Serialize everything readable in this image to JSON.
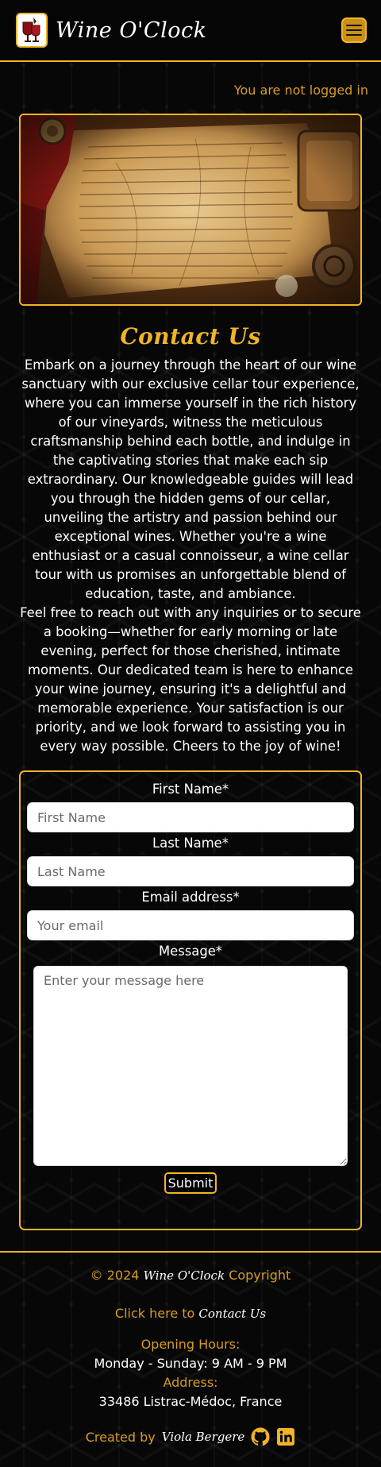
{
  "header": {
    "brand_name": "Wine O'Clock",
    "logo_icon": "wine-glass-icon",
    "menu_icon": "hamburger-menu-icon"
  },
  "login_status": "You are not logged in",
  "hero": {
    "image": "old-parchment-letters-image"
  },
  "main": {
    "title": "Contact Us",
    "intro_p1": "Embark on a journey through the heart of our wine sanctuary with our exclusive cellar tour experience, where you can immerse yourself in the rich history of our vineyards, witness the meticulous craftsmanship behind each bottle, and indulge in the captivating stories that make each sip extraordinary. Our knowledgeable guides will lead you through the hidden gems of our cellar, unveiling the artistry and passion behind our exceptional wines. Whether you're a wine enthusiast or a casual connoisseur, a wine cellar tour with us promises an unforgettable blend of education, taste, and ambiance.",
    "intro_p2": "Feel free to reach out with any inquiries or to secure a booking—whether for early morning or late evening, perfect for those cherished, intimate moments. Our dedicated team is here to enhance your wine journey, ensuring it's a delightful and memorable experience. Your satisfaction is our priority, and we look forward to assisting you in every way possible. Cheers to the joy of wine!"
  },
  "form": {
    "first_name_label": "First Name*",
    "first_name_placeholder": "First Name",
    "first_name_value": "",
    "last_name_label": "Last Name*",
    "last_name_placeholder": "Last Name",
    "last_name_value": "",
    "email_label": "Email address*",
    "email_placeholder": "Your email",
    "email_value": "",
    "message_label": "Message*",
    "message_placeholder": "Enter your message here",
    "message_value": "",
    "submit_label": "Submit"
  },
  "footer": {
    "copyright_prefix": "© 2024",
    "copyright_brand": "Wine O'Clock",
    "copyright_suffix": "Copyright",
    "contact_prefix": "Click here to",
    "contact_link": "Contact Us",
    "hours_label": "Opening Hours:",
    "hours_value": "Monday - Sunday: 9 AM - 9 PM",
    "address_label": "Address:",
    "address_value": "33486 Listrac-Médoc, France",
    "credits_prefix": "Created by",
    "credits_author": "Viola Bergere",
    "github_icon": "github-icon",
    "linkedin_icon": "linkedin-icon"
  },
  "colors": {
    "accent": "#f0b428",
    "accent_text": "#d89c23",
    "background": "#070707",
    "text": "#ffffff"
  }
}
